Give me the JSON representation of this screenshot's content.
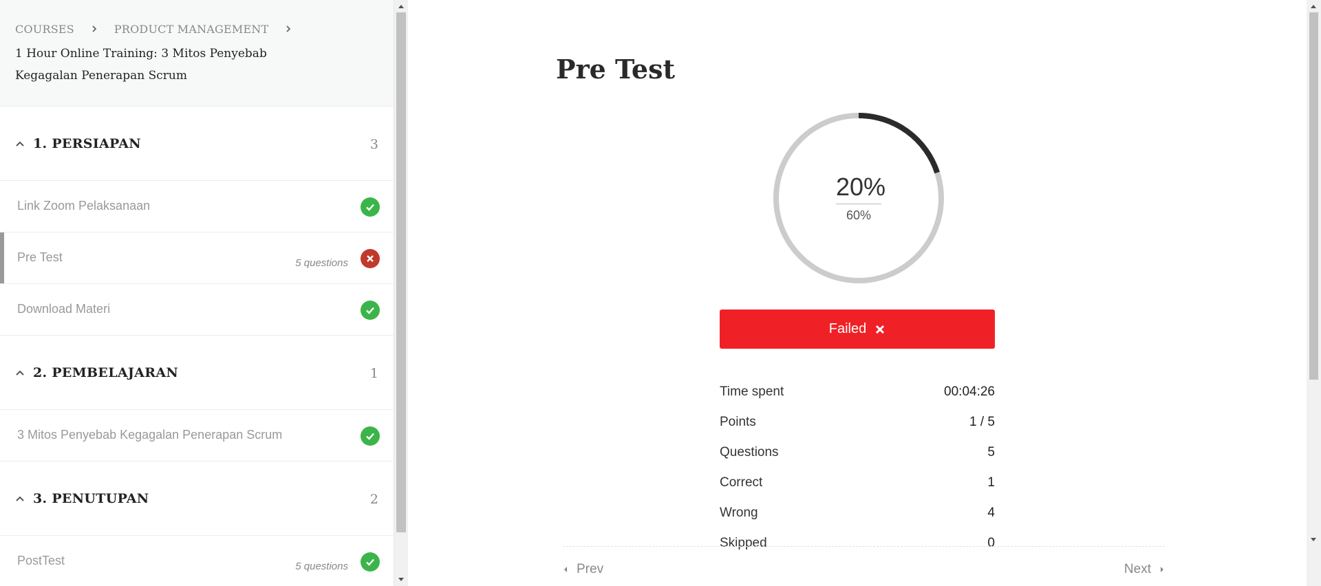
{
  "breadcrumb": {
    "items": [
      "COURSES",
      "PRODUCT MANAGEMENT"
    ]
  },
  "course": {
    "title": "1 Hour Online Training: 3 Mitos Penyebab Kegagalan Penerapan Scrum"
  },
  "sections": [
    {
      "title": "1. PERSIAPAN",
      "count": "3",
      "lessons": [
        {
          "title": "Link Zoom Pelaksanaan",
          "meta": "",
          "status": "complete"
        },
        {
          "title": "Pre Test",
          "meta": "5 questions",
          "status": "failed",
          "active": true
        },
        {
          "title": "Download Materi",
          "meta": "",
          "status": "complete"
        }
      ]
    },
    {
      "title": "2. PEMBELAJARAN",
      "count": "1",
      "lessons": [
        {
          "title": "3 Mitos Penyebab Kegagalan Penerapan Scrum",
          "meta": "",
          "status": "complete"
        }
      ]
    },
    {
      "title": "3. PENUTUPAN",
      "count": "2",
      "lessons": [
        {
          "title": "PostTest",
          "meta": "5 questions",
          "status": "complete"
        }
      ]
    }
  ],
  "quiz": {
    "title": "Pre Test",
    "score": "20%",
    "passing": "60%",
    "progress_fraction": 0.2,
    "result_label": "Failed",
    "stats": [
      {
        "label": "Time spent",
        "value": "00:04:26"
      },
      {
        "label": "Points",
        "value": "1 / 5"
      },
      {
        "label": "Questions",
        "value": "5"
      },
      {
        "label": "Correct",
        "value": "1"
      },
      {
        "label": "Wrong",
        "value": "4"
      },
      {
        "label": "Skipped",
        "value": "0"
      }
    ]
  },
  "nav": {
    "prev_label": "Prev",
    "next_label": "Next"
  },
  "colors": {
    "success": "#3bb54a",
    "fail_badge": "#c0392b",
    "fail_button": "#f02126",
    "ring_track": "#cccccc",
    "ring_fill": "#2b2b2b"
  },
  "icons": {
    "breadcrumb_separator": "chevron-right-icon",
    "section_toggle": "chevron-up-icon",
    "complete": "check-circle-icon",
    "failed": "x-circle-icon",
    "prev": "caret-left-icon",
    "next": "caret-right-icon"
  }
}
